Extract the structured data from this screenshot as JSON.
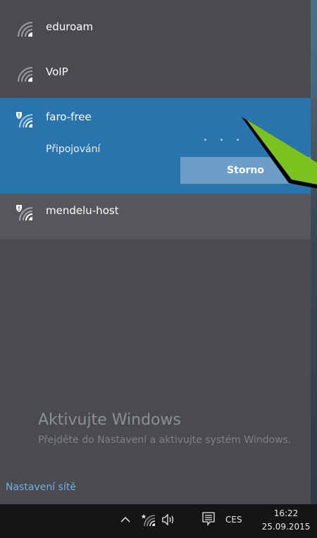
{
  "networks": [
    {
      "name": "eduroam",
      "secured": true,
      "open": false
    },
    {
      "name": "VoIP",
      "secured": true,
      "open": false
    },
    {
      "name": "faro-free",
      "open": true,
      "status": "Připojování",
      "cancel_label": "Storno"
    },
    {
      "name": "mendelu-host",
      "open": true
    }
  ],
  "watermark": {
    "title": "Aktivujte Windows",
    "subtitle": "Přejděte do Nastavení a aktivujte systém Windows."
  },
  "network_settings_link": "Nastavení sítě",
  "taskbar": {
    "language": "CES",
    "time": "16:22",
    "date": "25.09.2015",
    "icons": [
      "chevron-up-icon",
      "wifi-icon",
      "volume-icon",
      "notification-icon"
    ]
  },
  "colors": {
    "panel": "#4a4b4f",
    "active": "#2a74ad",
    "button": "#6d9ec8",
    "link": "#6fb0e6",
    "taskbar": "#141516",
    "arrow": "#7cc21f"
  }
}
